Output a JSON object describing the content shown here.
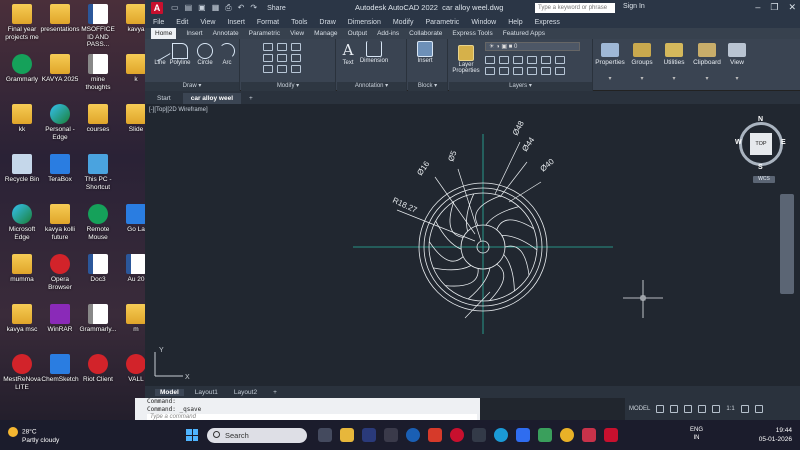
{
  "desktop": {
    "icons": [
      {
        "label": "Final year projects me",
        "kind": "folder",
        "col": 0,
        "row": 0
      },
      {
        "label": "presentations",
        "kind": "folder",
        "col": 1,
        "row": 0
      },
      {
        "label": "MSOFFICE ID AND PASS...",
        "kind": "doc",
        "col": 2,
        "row": 0
      },
      {
        "label": "kavya",
        "kind": "folder",
        "col": 3,
        "row": 0
      },
      {
        "label": "Grammarly",
        "kind": "app-green",
        "col": 0,
        "row": 1
      },
      {
        "label": "KAVYA 2025",
        "kind": "folder",
        "col": 1,
        "row": 1
      },
      {
        "label": "mine thoughts",
        "kind": "pdf",
        "col": 2,
        "row": 1
      },
      {
        "label": "k",
        "kind": "folder",
        "col": 3,
        "row": 1
      },
      {
        "label": "kk",
        "kind": "folder",
        "col": 0,
        "row": 2
      },
      {
        "label": "Personal - Edge",
        "kind": "app-edge",
        "col": 1,
        "row": 2
      },
      {
        "label": "courses",
        "kind": "folder",
        "col": 2,
        "row": 2
      },
      {
        "label": "Slide",
        "kind": "folder",
        "col": 3,
        "row": 2
      },
      {
        "label": "Recycle Bin",
        "kind": "app-bin",
        "col": 0,
        "row": 3
      },
      {
        "label": "TeraBox",
        "kind": "app-blue",
        "col": 1,
        "row": 3
      },
      {
        "label": "This PC - Shortcut",
        "kind": "app-pc",
        "col": 2,
        "row": 3
      },
      {
        "label": "Microsoft Edge",
        "kind": "app-edge",
        "col": 0,
        "row": 4
      },
      {
        "label": "kavya kolli future",
        "kind": "folder",
        "col": 1,
        "row": 4
      },
      {
        "label": "Remote Mouse",
        "kind": "app-green",
        "col": 2,
        "row": 4
      },
      {
        "label": "Go La",
        "kind": "app-blue",
        "col": 3,
        "row": 4
      },
      {
        "label": "mumma",
        "kind": "folder",
        "col": 0,
        "row": 5
      },
      {
        "label": "Opera Browser",
        "kind": "app-red",
        "col": 1,
        "row": 5
      },
      {
        "label": "Doc3",
        "kind": "doc",
        "col": 2,
        "row": 5
      },
      {
        "label": "Au 20",
        "kind": "doc",
        "col": 3,
        "row": 5
      },
      {
        "label": "kavya msc",
        "kind": "folder",
        "col": 0,
        "row": 6
      },
      {
        "label": "WinRAR",
        "kind": "app-rar",
        "col": 1,
        "row": 6
      },
      {
        "label": "Grammarly...",
        "kind": "pdf",
        "col": 2,
        "row": 6
      },
      {
        "label": "m",
        "kind": "folder",
        "col": 3,
        "row": 6
      },
      {
        "label": "MestReNova LITE",
        "kind": "app-red",
        "col": 0,
        "row": 7
      },
      {
        "label": "ChemSketch",
        "kind": "app-blue",
        "col": 1,
        "row": 7
      },
      {
        "label": "Riot Client",
        "kind": "app-red",
        "col": 2,
        "row": 7
      },
      {
        "label": "VALL",
        "kind": "app-red",
        "col": 3,
        "row": 7
      }
    ]
  },
  "app": {
    "logo": "A",
    "qat_icons": [
      "new-icon",
      "open-icon",
      "save-icon",
      "save-as-icon",
      "print-icon",
      "undo-icon",
      "redo-icon"
    ],
    "share_label": "Share",
    "title": "Autodesk AutoCAD 2022",
    "filename": "car alloy weel.dwg",
    "search_placeholder": "Type a keyword or phrase",
    "sign_in": "Sign In",
    "window_controls": [
      "–",
      "❐",
      "✕"
    ]
  },
  "menubar": [
    "File",
    "Edit",
    "View",
    "Insert",
    "Format",
    "Tools",
    "Draw",
    "Dimension",
    "Modify",
    "Parametric",
    "Window",
    "Help",
    "Express"
  ],
  "ribbon_tabs": [
    "Home",
    "Insert",
    "Annotate",
    "Parametric",
    "View",
    "Manage",
    "Output",
    "Add-ins",
    "Collaborate",
    "Express Tools",
    "Featured Apps"
  ],
  "ribbon": {
    "draw_tools": [
      "Line",
      "Polyline",
      "Circle",
      "Arc"
    ],
    "draw_title": "Draw ▾",
    "modify_title": "Modify ▾",
    "annotation": {
      "text": "Text",
      "dimension": "Dimension",
      "title": "Annotation ▾"
    },
    "block": {
      "insert": "Insert",
      "title": "Block ▾"
    },
    "layers": {
      "properties": "Layer Properties",
      "current": "0",
      "title": "Layers ▾"
    },
    "right_buttons": [
      "Properties",
      "Groups",
      "Utilities",
      "Clipboard",
      "View"
    ]
  },
  "file_tabs": [
    "Start",
    "car alloy weel",
    "+"
  ],
  "viewport": {
    "label": "[-][Top][2D Wireframe]",
    "dimensions": [
      "Ø16",
      "Ø5",
      "Ø48",
      "Ø44",
      "Ø40",
      "R18.27"
    ],
    "viewcube": {
      "top": "TOP",
      "n": "N",
      "s": "S",
      "e": "E",
      "w": "W",
      "wcs": "WCS"
    },
    "ucs": {
      "x": "X",
      "y": "Y"
    }
  },
  "layout_tabs": [
    "Model",
    "Layout1",
    "Layout2",
    "+"
  ],
  "command": {
    "history": [
      "Command:",
      "Command: _qsave"
    ],
    "placeholder": "Type a command"
  },
  "statusbar": {
    "model": "MODEL",
    "scale": "1:1"
  },
  "taskbar": {
    "temp": "28°C",
    "weather": "Partly cloudy",
    "search": "Search",
    "lang": "ENG",
    "region": "IN",
    "time": "19:44",
    "date": "05-01-2026"
  },
  "colors": {
    "accent": "#2a7de1",
    "autocad_red": "#c8102e",
    "cad_green": "#2bb5a2",
    "cad_white": "#e8ecef"
  }
}
